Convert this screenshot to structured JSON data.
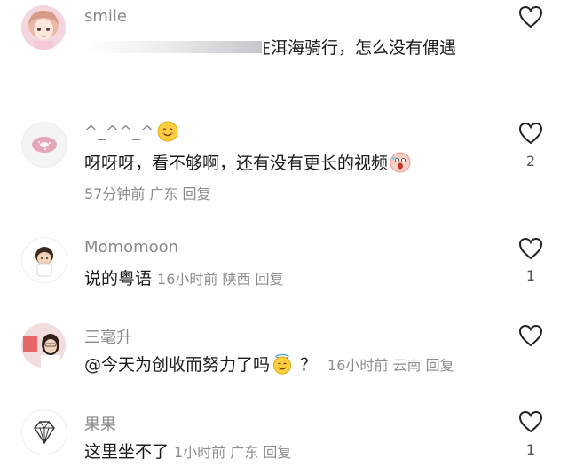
{
  "comments": [
    {
      "username": "smile",
      "text": "洱海骑行，怎么没有偶遇",
      "text_prefix_partial": "在"
    },
    {
      "username": "^_^^_^",
      "username_emoji": "smiling-face-emoji",
      "text": "呀呀呀，看不够啊，还有没有更长的视频",
      "text_emoji": "shocked-face-emoji",
      "meta": "57分钟前 广东 回复",
      "likes": "2"
    },
    {
      "username": "Momomoon",
      "text": "说的粤语",
      "meta": "16小时前 陕西 回复",
      "likes": "1"
    },
    {
      "username": "三毫升",
      "text": "@今天为创收而努力了吗",
      "text_emoji": "halo-face-emoji",
      "text_suffix": "？",
      "meta": "16小时前 云南 回复"
    },
    {
      "username": "果果",
      "text": "这里坐不了",
      "meta": "1小时前 广东 回复",
      "likes": "1"
    }
  ],
  "icons": {
    "like": "heart-outline-icon",
    "avatar_4": "diamond-icon"
  },
  "colors": {
    "username": "#8a8a8a",
    "text": "#1b1b1b",
    "meta": "#8d8d8d"
  }
}
